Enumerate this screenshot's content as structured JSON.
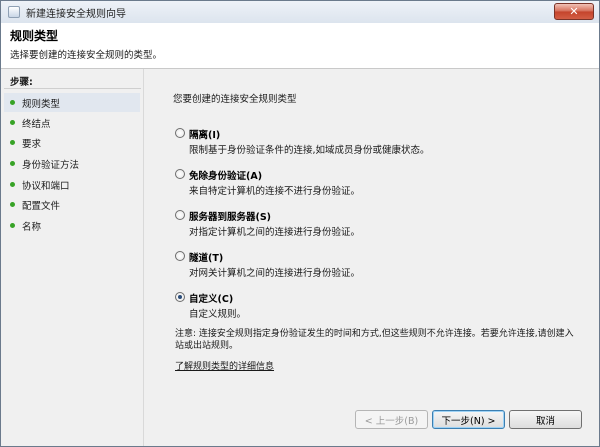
{
  "window": {
    "title": "新建连接安全规则向导",
    "close_label": "✕"
  },
  "header": {
    "title": "规则类型",
    "subtitle": "选择要创建的连接安全规则的类型。"
  },
  "sidebar": {
    "steps_label": "步骤:",
    "items": [
      {
        "label": "规则类型",
        "active": true
      },
      {
        "label": "终结点"
      },
      {
        "label": "要求"
      },
      {
        "label": "身份验证方法"
      },
      {
        "label": "协议和端口"
      },
      {
        "label": "配置文件"
      },
      {
        "label": "名称"
      }
    ]
  },
  "main": {
    "prompt": "您要创建的连接安全规则类型",
    "options": [
      {
        "title": "隔离(I)",
        "desc": "限制基于身份验证条件的连接,如域成员身份或健康状态。",
        "checked": false
      },
      {
        "title": "免除身份验证(A)",
        "desc": "来自特定计算机的连接不进行身份验证。",
        "checked": false
      },
      {
        "title": "服务器到服务器(S)",
        "desc": "对指定计算机之间的连接进行身份验证。",
        "checked": false
      },
      {
        "title": "隧道(T)",
        "desc": "对网关计算机之间的连接进行身份验证。",
        "checked": false
      },
      {
        "title": "自定义(C)",
        "desc": "自定义规则。",
        "checked": true
      }
    ],
    "note": "注意: 连接安全规则指定身份验证发生的时间和方式,但这些规则不允许连接。若要允许连接,请创建入站或出站规则。",
    "learn_more": "了解规则类型的详细信息"
  },
  "buttons": {
    "back": "< 上一步(B)",
    "next": "下一步(N) >",
    "cancel": "取消"
  },
  "colors": {
    "step_dot": "#37a326",
    "active_step_bg": "#e1e7ef",
    "close_button": "#c4432b"
  }
}
